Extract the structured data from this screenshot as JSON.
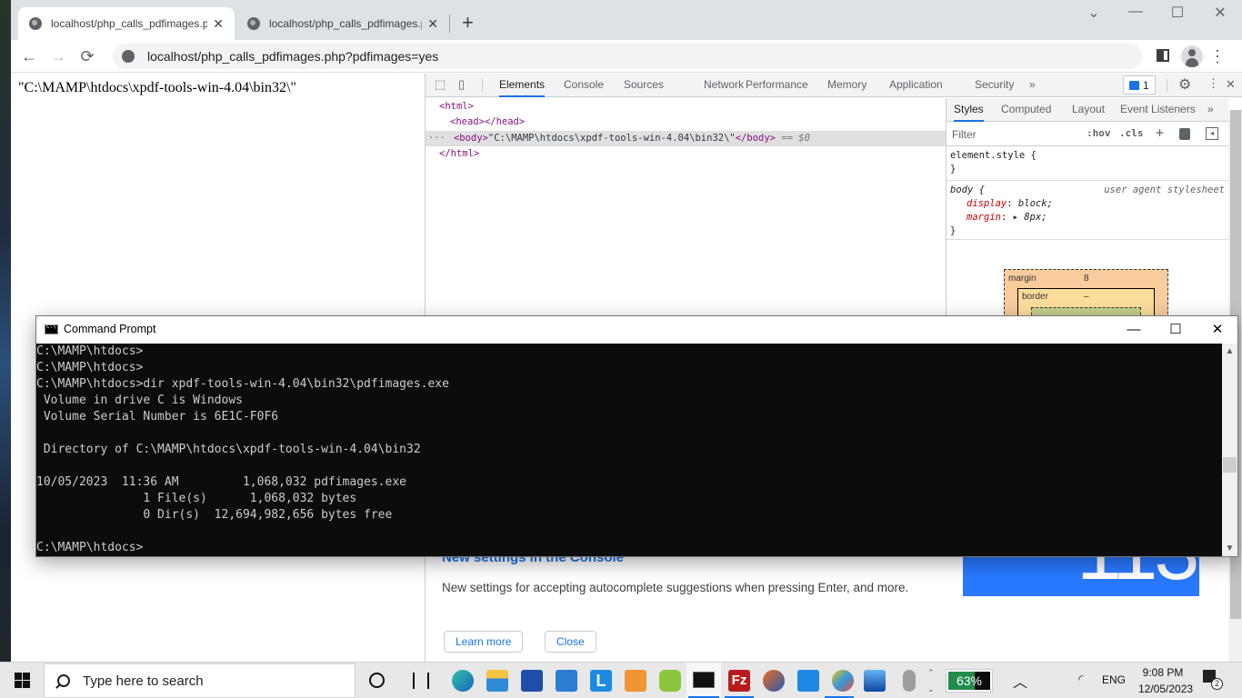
{
  "browser": {
    "tabs": [
      {
        "title": "localhost/php_calls_pdfimages.ph",
        "active": true
      },
      {
        "title": "localhost/php_calls_pdfimages.ph",
        "active": false
      }
    ],
    "new_tab": "+",
    "window_controls": {
      "tab_search": "⌄",
      "minimize": "—",
      "maximize": "☐",
      "close": "✕"
    },
    "nav": {
      "back": "←",
      "forward": "→",
      "reload": "⟳"
    },
    "url": "localhost/php_calls_pdfimages.php?pdfimages=yes",
    "menu": "⋮"
  },
  "page": {
    "body_text": "\"C:\\MAMP\\htdocs\\xpdf-tools-win-4.04\\bin32\\\""
  },
  "devtools": {
    "tabs": [
      "Elements",
      "Console",
      "Sources",
      "Network",
      "Performance",
      "Memory",
      "Application",
      "Security"
    ],
    "active_tab": "Elements",
    "more_tabs": "»",
    "issues_count": "1",
    "settings": "⚙",
    "menu": "⋮",
    "close": "✕",
    "dom": [
      {
        "open": "<html>",
        "text": "",
        "close": "",
        "indent": 0,
        "selected": false
      },
      {
        "open": "<head>",
        "text": "",
        "close": "</head>",
        "indent": 1,
        "selected": false
      },
      {
        "open": "<body>",
        "text": "\"C:\\MAMP\\htdocs\\xpdf-tools-win-4.04\\bin32\\\"",
        "close": "</body>",
        "indent": 1,
        "selected": true,
        "suffix": "== $0"
      },
      {
        "open": "</html>",
        "text": "",
        "close": "",
        "indent": 0,
        "selected": false
      }
    ],
    "dom_ellipsis": "···",
    "styles": {
      "tabs": [
        "Styles",
        "Computed",
        "Layout",
        "Event Listeners"
      ],
      "active_tab": "Styles",
      "more": "»",
      "filter_placeholder": "Filter",
      "hov": ":hov",
      "cls": ".cls",
      "add": "+",
      "element_style_open": "element.style {",
      "element_style_close": "}",
      "rule_selector": "body {",
      "rule_source": "user agent stylesheet",
      "rule_props": [
        {
          "name": "display",
          "value": "block;"
        },
        {
          "name": "margin",
          "value": "▸ 8px;"
        }
      ],
      "rule_close": "}",
      "box_model": {
        "margin_label": "margin",
        "margin_value": "8",
        "border_label": "border",
        "border_value": "–"
      }
    },
    "whats_new": {
      "title": "New settings in the Console",
      "description": "New settings for accepting autocomplete suggestions when pressing Enter, and more.",
      "learn_more": "Learn more",
      "close": "Close",
      "version_badge": "113"
    }
  },
  "cmd": {
    "title": "Command Prompt",
    "controls": {
      "minimize": "—",
      "maximize": "☐",
      "close": "✕"
    },
    "lines": [
      "C:\\MAMP\\htdocs>",
      "C:\\MAMP\\htdocs>",
      "C:\\MAMP\\htdocs>dir xpdf-tools-win-4.04\\bin32\\pdfimages.exe",
      " Volume in drive C is Windows",
      " Volume Serial Number is 6E1C-F0F6",
      "",
      " Directory of C:\\MAMP\\htdocs\\xpdf-tools-win-4.04\\bin32",
      "",
      "10/05/2023  11:36 AM         1,068,032 pdfimages.exe",
      "               1 File(s)      1,068,032 bytes",
      "               0 Dir(s)  12,694,982,656 bytes free",
      "",
      "C:\\MAMP\\htdocs>"
    ]
  },
  "taskbar": {
    "search_placeholder": "Type here to search",
    "apps": [
      "cortana",
      "task-view",
      "edge",
      "file-explorer",
      "microsoft-store",
      "mail",
      "lexicon",
      "app-orange",
      "vmware",
      "command-prompt",
      "filezilla",
      "snipping-tool",
      "app-blue",
      "paint",
      "photos",
      "microphone"
    ],
    "battery_percent": 63,
    "battery_label": "63%",
    "language": "ENG",
    "time": "9:08 PM",
    "date": "12/05/2023",
    "notifications_count": "2"
  }
}
